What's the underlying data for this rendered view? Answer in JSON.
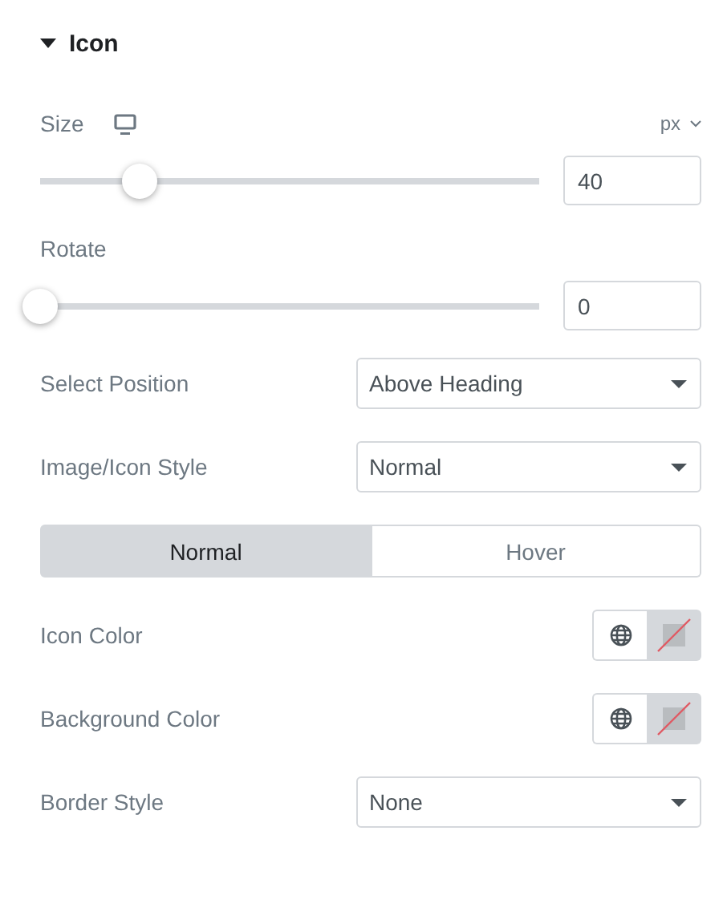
{
  "section": {
    "title": "Icon",
    "expanded": true
  },
  "controls": [
    {
      "kind": "slider",
      "label": "Size",
      "responsive": true,
      "unit": "px",
      "level": 0.2,
      "value": "40"
    },
    {
      "kind": "slider",
      "label": "Rotate",
      "responsive": false,
      "level": 0,
      "value": "0"
    },
    {
      "kind": "select",
      "label": "Select Position",
      "value": "Above Heading"
    },
    {
      "kind": "select",
      "label": "Image/Icon Style",
      "value": "Normal"
    },
    {
      "kind": "tabs",
      "tabs": [
        {
          "label": "Normal",
          "selected": true
        },
        {
          "label": "Hover",
          "selected": false
        }
      ]
    },
    {
      "kind": "color",
      "label": "Icon Color"
    },
    {
      "kind": "color",
      "label": "Background Color"
    },
    {
      "kind": "select",
      "label": "Border Style",
      "value": "None"
    }
  ]
}
